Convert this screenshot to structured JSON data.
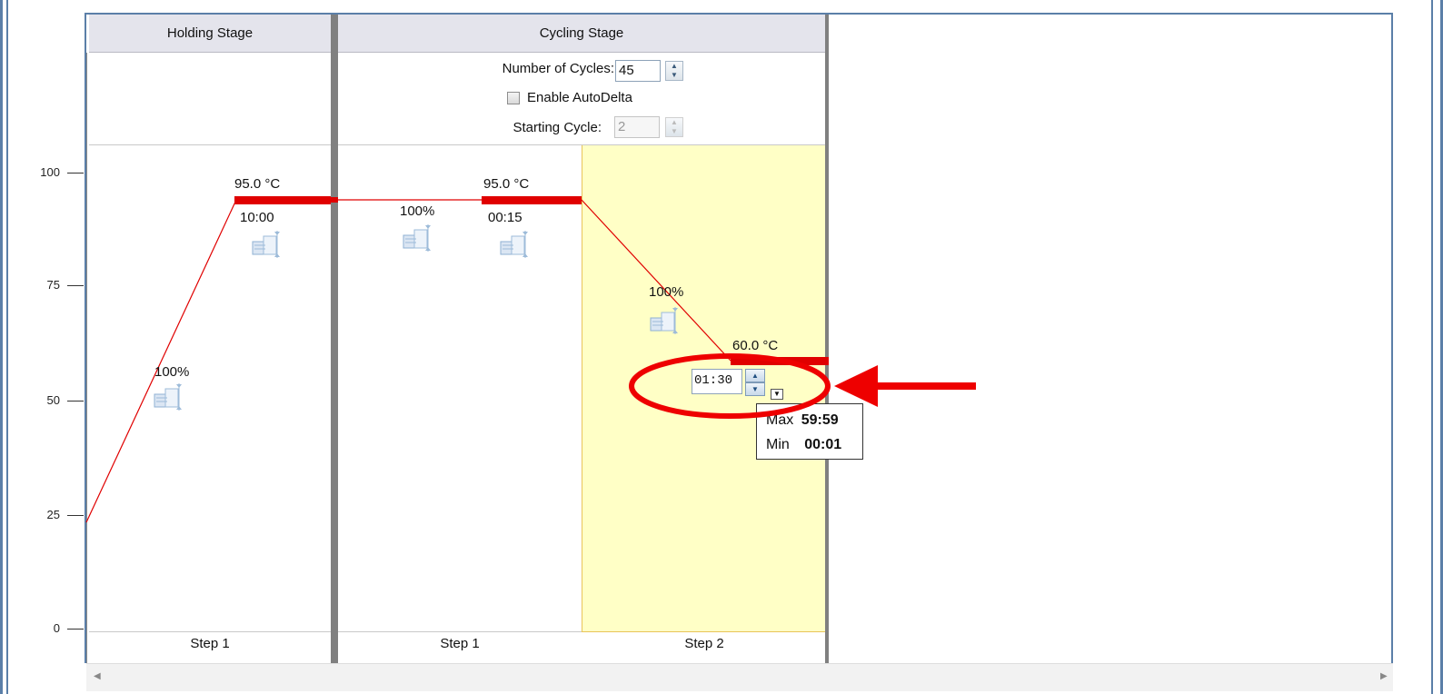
{
  "y_axis": {
    "ticks": [
      "100",
      "75",
      "50",
      "25",
      "0"
    ],
    "tick_values": [
      100,
      75,
      50,
      25,
      0
    ]
  },
  "stages": [
    {
      "title": "Holding Stage",
      "steps": [
        {
          "label": "Step 1",
          "temperature": "95.0 °C",
          "time": "10:00",
          "ramp_rate": "100%"
        }
      ]
    },
    {
      "title": "Cycling Stage",
      "controls": {
        "cycles_label": "Number of Cycles:",
        "cycles_value": "45",
        "autodelta_label": "Enable AutoDelta",
        "autodelta_checked": false,
        "starting_cycle_label": "Starting Cycle:",
        "starting_cycle_value": "2"
      },
      "steps": [
        {
          "label": "Step 1",
          "temperature": "95.0 °C",
          "time": "00:15",
          "ramp_rate": "100%"
        },
        {
          "label": "Step 2",
          "temperature": "60.0 °C",
          "time": "01:30",
          "ramp_rate": "100%",
          "selected": true
        }
      ]
    }
  ],
  "tooltip": {
    "max_label": "Max",
    "max_value": "59:59",
    "min_label": "Min",
    "min_value": "00:01"
  },
  "colors": {
    "profile_line": "#e00000",
    "hold_bar": "#e00000",
    "selected_step_bg": "#ffffc6",
    "annotation": "#ee0000"
  },
  "icons": {
    "spin_up": "▲",
    "spin_down": "▼",
    "dropdown": "▼",
    "scroll_left": "◀",
    "scroll_right": "▶"
  }
}
